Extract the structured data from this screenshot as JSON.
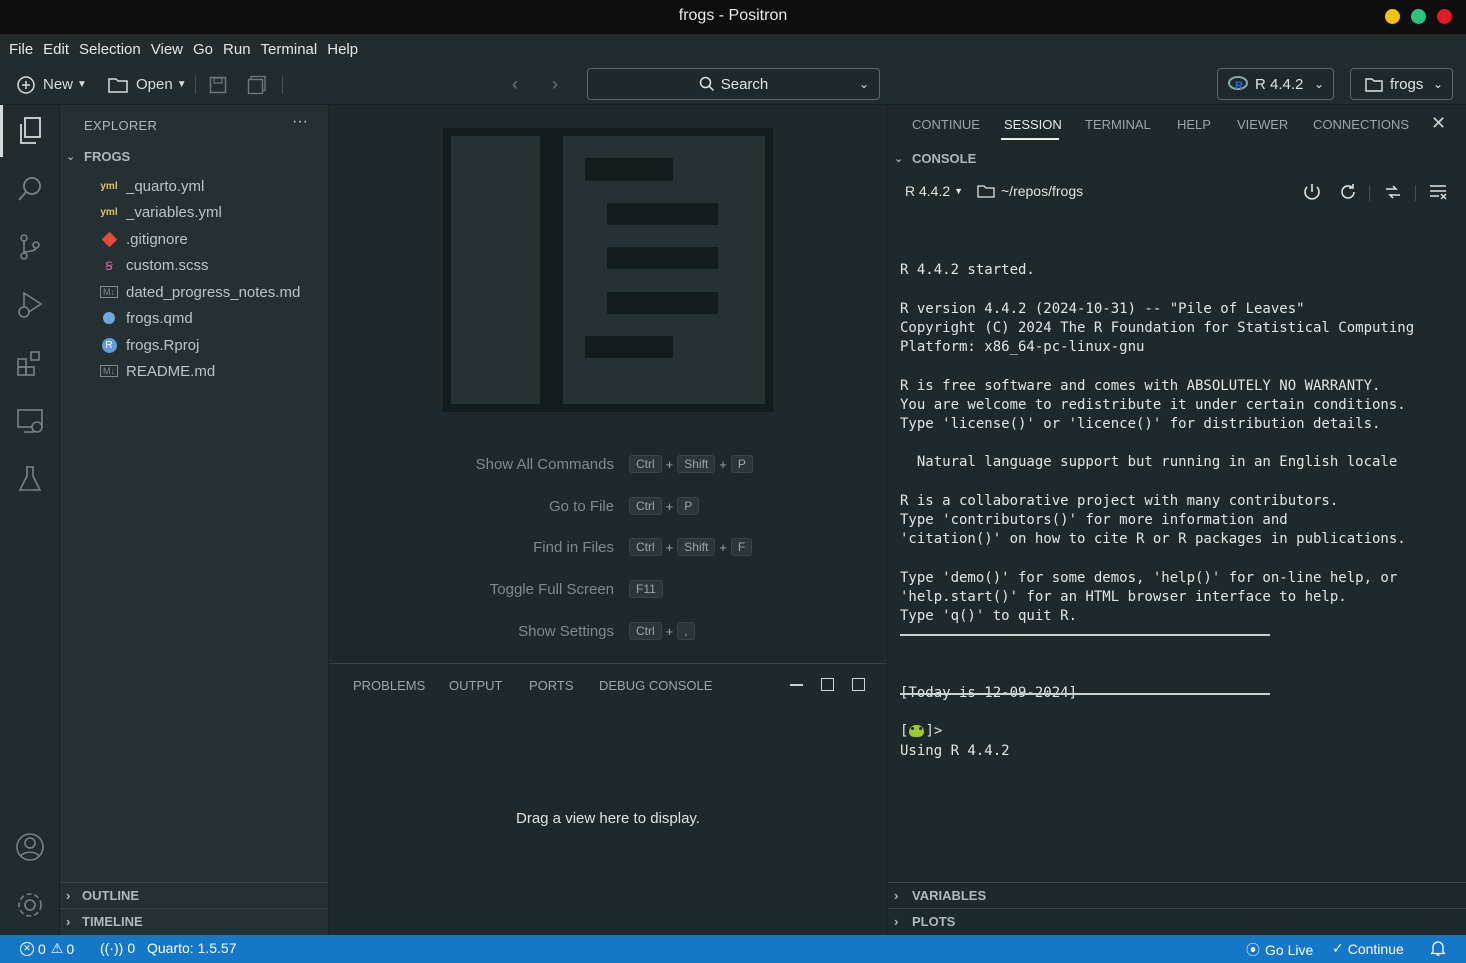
{
  "window": {
    "title": "frogs - Positron"
  },
  "menu": [
    "File",
    "Edit",
    "Selection",
    "View",
    "Go",
    "Run",
    "Terminal",
    "Help"
  ],
  "toolbar": {
    "new_label": "New",
    "open_label": "Open",
    "search_label": "Search",
    "r_version": "R 4.4.2",
    "project": "frogs"
  },
  "sidebar": {
    "header": "EXPLORER",
    "folder": "FROGS",
    "files": [
      {
        "name": "_quarto.yml",
        "icon": "yaml-icon"
      },
      {
        "name": "_variables.yml",
        "icon": "yaml-icon"
      },
      {
        "name": ".gitignore",
        "icon": "git-icon"
      },
      {
        "name": "custom.scss",
        "icon": "sass-icon"
      },
      {
        "name": "dated_progress_notes.md",
        "icon": "markdown-icon"
      },
      {
        "name": "frogs.qmd",
        "icon": "quarto-icon"
      },
      {
        "name": "frogs.Rproj",
        "icon": "r-project-icon"
      },
      {
        "name": "README.md",
        "icon": "markdown-icon"
      }
    ],
    "outline": "OUTLINE",
    "timeline": "TIMELINE"
  },
  "editor": {
    "shortcuts": [
      {
        "label": "Show All Commands",
        "keys": [
          "Ctrl",
          "Shift",
          "P"
        ]
      },
      {
        "label": "Go to File",
        "keys": [
          "Ctrl",
          "P"
        ]
      },
      {
        "label": "Find in Files",
        "keys": [
          "Ctrl",
          "Shift",
          "F"
        ]
      },
      {
        "label": "Toggle Full Screen",
        "keys": [
          "F11"
        ]
      },
      {
        "label": "Show Settings",
        "keys": [
          "Ctrl",
          ","
        ]
      }
    ]
  },
  "panel": {
    "tabs": [
      "PROBLEMS",
      "OUTPUT",
      "PORTS",
      "DEBUG CONSOLE"
    ],
    "empty_message": "Drag a view here to display."
  },
  "rightpane": {
    "tabs": [
      "CONTINUE",
      "SESSION",
      "TERMINAL",
      "HELP",
      "VIEWER",
      "CONNECTIONS"
    ],
    "active_tab": "SESSION",
    "console_header": "CONSOLE",
    "console_r_version": "R 4.4.2",
    "console_path": "~/repos/frogs",
    "console_text": "R 4.4.2 started.\n\nR version 4.4.2 (2024-10-31) -- \"Pile of Leaves\"\nCopyright (C) 2024 The R Foundation for Statistical Computing\nPlatform: x86_64-pc-linux-gnu\n\nR is free software and comes with ABSOLUTELY NO WARRANTY.\nYou are welcome to redistribute it under certain conditions.\nType 'license()' or 'licence()' for distribution details.\n\n  Natural language support but running in an English locale\n\nR is a collaborative project with many contributors.\nType 'contributors()' for more information and\n'citation()' on how to cite R or R packages in publications.\n\nType 'demo()' for some demos, 'help()' for on-line help, or\n'help.start()' for an HTML browser interface to help.\nType 'q()' to quit R.",
    "banner_lines": [
      "[Today is 12-09-2024]",
      "Using R 4.4.2"
    ],
    "prompt_left": "[",
    "prompt_right": "]>",
    "variables": "VARIABLES",
    "plots": "PLOTS"
  },
  "status": {
    "errors": "0",
    "warnings": "0",
    "ports": "0",
    "quarto": "Quarto: 1.5.57",
    "go_live": "Go Live",
    "continue": "Continue"
  },
  "colors": {
    "accent": "#1577c8",
    "bg": "#1f282a",
    "sidebar": "#253033"
  }
}
